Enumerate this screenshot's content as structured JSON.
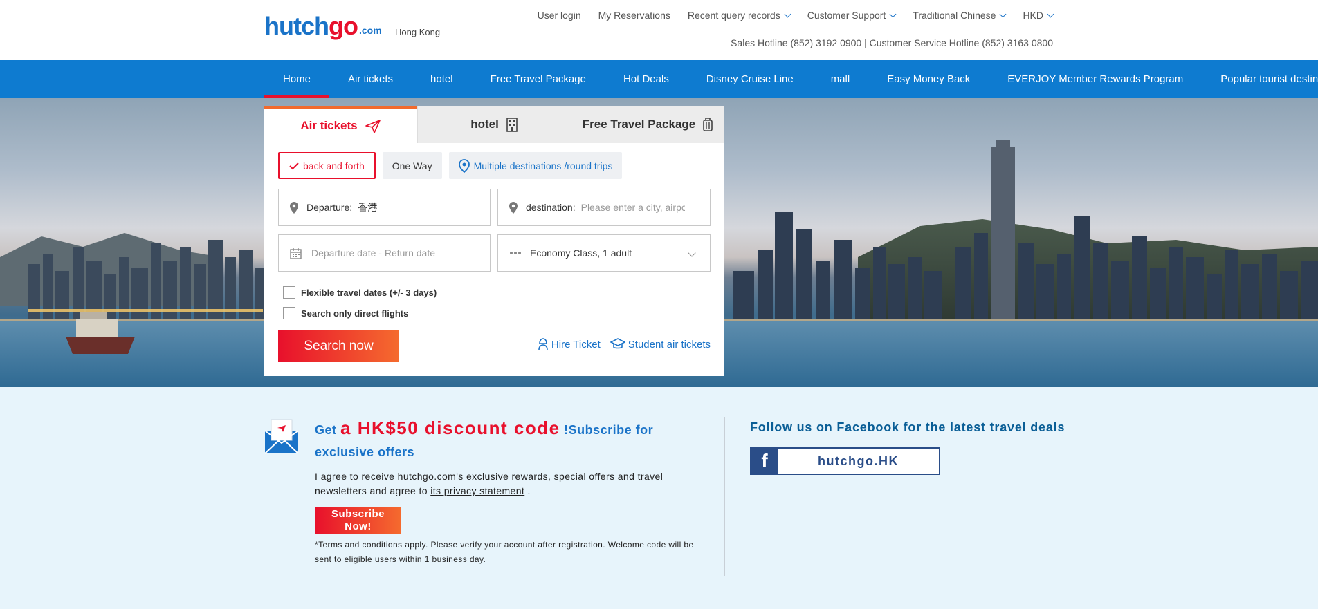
{
  "header": {
    "logo_main": "hutchgo",
    "logo_suffix": ".com",
    "region": "Hong Kong",
    "nav": [
      {
        "label": "User login",
        "dropdown": false
      },
      {
        "label": "My Reservations",
        "dropdown": false
      },
      {
        "label": "Recent query records",
        "dropdown": true
      },
      {
        "label": "Customer Support",
        "dropdown": true
      },
      {
        "label": "Traditional Chinese",
        "dropdown": true
      },
      {
        "label": "HKD",
        "dropdown": true
      }
    ],
    "hotline": "Sales Hotline (852) 3192 0900 | Customer Service Hotline (852) 3163 0800"
  },
  "main_nav": [
    "Home",
    "Air tickets",
    "hotel",
    "Free Travel Package",
    "Hot Deals",
    "Disney Cruise Line",
    "mall",
    "Easy Money Back",
    "EVERJOY Member Rewards Program",
    "Popular tourist destinations"
  ],
  "search": {
    "tabs": [
      {
        "label": "Air tickets",
        "icon": "plane-icon"
      },
      {
        "label": "hotel",
        "icon": "building-icon"
      },
      {
        "label": "Free Travel Package",
        "icon": "luggage-icon"
      }
    ],
    "trip_types": [
      "back and forth",
      "One Way",
      "Multiple destinations /round trips"
    ],
    "departure_label": "Departure:",
    "departure_value": "香港",
    "destination_label": "destination:",
    "destination_placeholder": "Please enter a city, airport",
    "dates_placeholder": "Departure date - Return date",
    "cabin_value": "Economy Class, 1 adult",
    "flexible_label": "Flexible travel dates (+/- 3 days)",
    "direct_label": "Search only direct flights",
    "search_button": "Search now",
    "hire_ticket": "Hire Ticket",
    "student_tickets": "Student air tickets"
  },
  "promo": {
    "title_prefix": "Get",
    "title_highlight": "a HK$50 discount code",
    "title_suffix": "!Subscribe for exclusive offers",
    "text_before_link": "I agree to receive hutchgo.com's exclusive rewards, special offers and travel newsletters and agree to",
    "link_text": "its privacy statement",
    "text_after_link": ".",
    "subscribe_button": "Subscribe Now!",
    "terms": "*Terms and conditions apply. Please verify your account after registration. Welcome code will be sent to eligible users within 1 business day."
  },
  "facebook": {
    "title": "Follow us on Facebook for the latest travel deals",
    "handle": "hutchgo.HK"
  },
  "colors": {
    "brand_blue": "#1a73c8",
    "nav_blue": "#0e7bd0",
    "brand_red": "#e8102c",
    "orange": "#f56b2e",
    "bottom_bg": "#e7f4fb"
  }
}
